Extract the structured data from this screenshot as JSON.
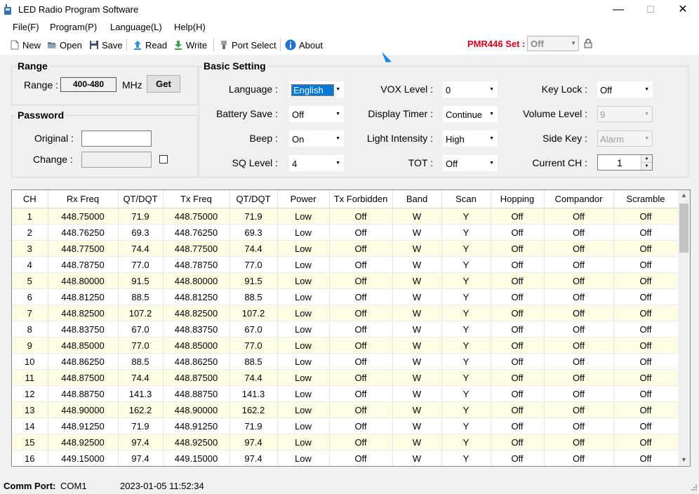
{
  "window": {
    "title": "LED Radio Program Software",
    "minimize": "—",
    "maximize": "☐",
    "close": "✕"
  },
  "menu": {
    "file": "File(F)",
    "program": "Program(P)",
    "language": "Language(L)",
    "help": "Help(H)"
  },
  "toolbar": {
    "new": "New",
    "open": "Open",
    "save": "Save",
    "read": "Read",
    "write": "Write",
    "port_select": "Port Select",
    "about": "About",
    "pmr_label": "PMR446 Set :",
    "pmr_value": "Off"
  },
  "range": {
    "title": "Range",
    "label": "Range :",
    "value": "400-480",
    "unit": "MHz",
    "get": "Get"
  },
  "password": {
    "title": "Password",
    "original_label": "Original :",
    "change_label": "Change :"
  },
  "basic": {
    "title": "Basic Setting",
    "language_label": "Language :",
    "language_value": "English",
    "battery_label": "Battery Save :",
    "battery_value": "Off",
    "beep_label": "Beep :",
    "beep_value": "On",
    "sq_label": "SQ Level :",
    "sq_value": "4",
    "vox_label": "VOX Level :",
    "vox_value": "0",
    "display_label": "Display Timer :",
    "display_value": "Continue",
    "light_label": "Light Intensity :",
    "light_value": "High",
    "tot_label": "TOT :",
    "tot_value": "Off",
    "keylock_label": "Key Lock :",
    "keylock_value": "Off",
    "volume_label": "Volume Level :",
    "volume_value": "9",
    "sidekey_label": "Side Key :",
    "sidekey_value": "Alarm",
    "currentch_label": "Current CH :",
    "currentch_value": "1"
  },
  "grid": {
    "columns": [
      "CH",
      "Rx Freq",
      "QT/DQT",
      "Tx Freq",
      "QT/DQT",
      "Power",
      "Tx Forbidden",
      "Band",
      "Scan",
      "Hopping",
      "Compandor",
      "Scramble"
    ],
    "rows": [
      [
        "1",
        "448.75000",
        "71.9",
        "448.75000",
        "71.9",
        "Low",
        "Off",
        "W",
        "Y",
        "Off",
        "Off",
        "Off"
      ],
      [
        "2",
        "448.76250",
        "69.3",
        "448.76250",
        "69.3",
        "Low",
        "Off",
        "W",
        "Y",
        "Off",
        "Off",
        "Off"
      ],
      [
        "3",
        "448.77500",
        "74.4",
        "448.77500",
        "74.4",
        "Low",
        "Off",
        "W",
        "Y",
        "Off",
        "Off",
        "Off"
      ],
      [
        "4",
        "448.78750",
        "77.0",
        "448.78750",
        "77.0",
        "Low",
        "Off",
        "W",
        "Y",
        "Off",
        "Off",
        "Off"
      ],
      [
        "5",
        "448.80000",
        "91.5",
        "448.80000",
        "91.5",
        "Low",
        "Off",
        "W",
        "Y",
        "Off",
        "Off",
        "Off"
      ],
      [
        "6",
        "448.81250",
        "88.5",
        "448.81250",
        "88.5",
        "Low",
        "Off",
        "W",
        "Y",
        "Off",
        "Off",
        "Off"
      ],
      [
        "7",
        "448.82500",
        "107.2",
        "448.82500",
        "107.2",
        "Low",
        "Off",
        "W",
        "Y",
        "Off",
        "Off",
        "Off"
      ],
      [
        "8",
        "448.83750",
        "67.0",
        "448.83750",
        "67.0",
        "Low",
        "Off",
        "W",
        "Y",
        "Off",
        "Off",
        "Off"
      ],
      [
        "9",
        "448.85000",
        "77.0",
        "448.85000",
        "77.0",
        "Low",
        "Off",
        "W",
        "Y",
        "Off",
        "Off",
        "Off"
      ],
      [
        "10",
        "448.86250",
        "88.5",
        "448.86250",
        "88.5",
        "Low",
        "Off",
        "W",
        "Y",
        "Off",
        "Off",
        "Off"
      ],
      [
        "11",
        "448.87500",
        "74.4",
        "448.87500",
        "74.4",
        "Low",
        "Off",
        "W",
        "Y",
        "Off",
        "Off",
        "Off"
      ],
      [
        "12",
        "448.88750",
        "141.3",
        "448.88750",
        "141.3",
        "Low",
        "Off",
        "W",
        "Y",
        "Off",
        "Off",
        "Off"
      ],
      [
        "13",
        "448.90000",
        "162.2",
        "448.90000",
        "162.2",
        "Low",
        "Off",
        "W",
        "Y",
        "Off",
        "Off",
        "Off"
      ],
      [
        "14",
        "448.91250",
        "71.9",
        "448.91250",
        "71.9",
        "Low",
        "Off",
        "W",
        "Y",
        "Off",
        "Off",
        "Off"
      ],
      [
        "15",
        "448.92500",
        "97.4",
        "448.92500",
        "97.4",
        "Low",
        "Off",
        "W",
        "Y",
        "Off",
        "Off",
        "Off"
      ],
      [
        "16",
        "449.15000",
        "97.4",
        "449.15000",
        "97.4",
        "Low",
        "Off",
        "W",
        "Y",
        "Off",
        "Off",
        "Off"
      ]
    ]
  },
  "status": {
    "comm_label": "Comm Port:",
    "comm_value": "COM1",
    "datetime": "2023-01-05 11:52:34"
  },
  "colors": {
    "accent": "#0078d7",
    "pmr_label": "#d4001a",
    "row_alt": "#fdfde3"
  }
}
